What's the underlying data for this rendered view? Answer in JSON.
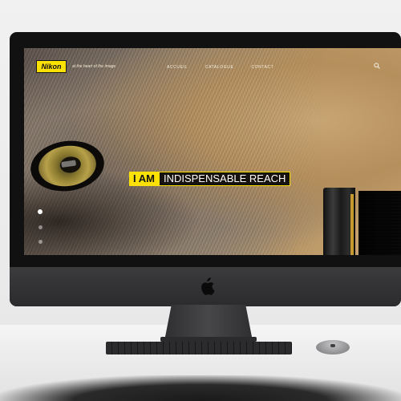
{
  "site": {
    "logo_text": "Nikon",
    "tagline": "at the heart of the image",
    "nav": [
      "ACCUEIL",
      "CATALOGUE",
      "CONTACT"
    ],
    "search_icon": "search-icon"
  },
  "hero": {
    "highlight": "I AM",
    "headline": "INDISPENSABLE REACH"
  },
  "slider": {
    "dots": 3,
    "active_index": 0
  },
  "colors": {
    "brand_yellow": "#ffe100",
    "hero_dark": "#161310"
  }
}
